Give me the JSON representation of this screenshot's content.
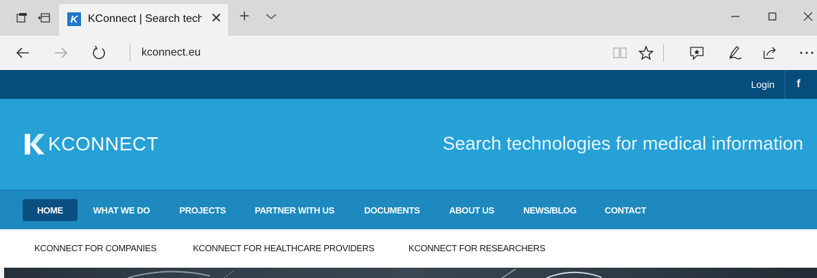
{
  "browser": {
    "tab_title": "KConnect | Search techr",
    "favicon_letter": "K",
    "url": "kconnect.eu"
  },
  "topbar": {
    "login": "Login",
    "facebook": "f"
  },
  "header": {
    "logo_text": "KCONNECT",
    "tagline": "Search technologies for medical information"
  },
  "main_nav": {
    "items": [
      {
        "label": "HOME",
        "active": true
      },
      {
        "label": "WHAT WE DO"
      },
      {
        "label": "PROJECTS"
      },
      {
        "label": "PARTNER WITH US"
      },
      {
        "label": "DOCUMENTS"
      },
      {
        "label": "ABOUT US"
      },
      {
        "label": "NEWS/BLOG"
      },
      {
        "label": "CONTACT"
      }
    ]
  },
  "sub_nav": {
    "items": [
      {
        "label": "KCONNECT FOR COMPANIES"
      },
      {
        "label": "KCONNECT FOR HEALTHCARE PROVIDERS"
      },
      {
        "label": "KCONNECT FOR RESEARCHERS"
      }
    ]
  },
  "colors": {
    "top_strip": "#064d7c",
    "hero": "#25a1d6",
    "main_nav": "#1d89bf",
    "active_nav": "#0b4f80"
  }
}
